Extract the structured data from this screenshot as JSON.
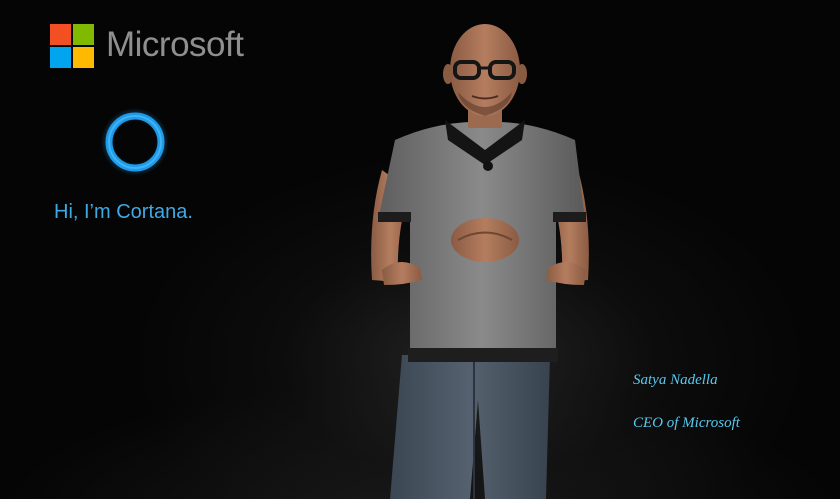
{
  "brand": {
    "wordmark": "Microsoft",
    "logo_colors": [
      "#f25022",
      "#7fba00",
      "#00a4ef",
      "#ffb900"
    ],
    "wordmark_color": "#8f8f8f"
  },
  "cortana": {
    "greeting": "Hi, I’m Cortana.",
    "ring_icon": "cortana-ring-icon",
    "accent": "#3fa9e4"
  },
  "photo": {
    "subject": "person-standing",
    "shirt_color": "#7a7a7a",
    "jeans_color": "#4c5866"
  },
  "caption": {
    "name": "Satya Nadella",
    "title": "CEO of Microsoft",
    "color": "#58c9ee"
  }
}
